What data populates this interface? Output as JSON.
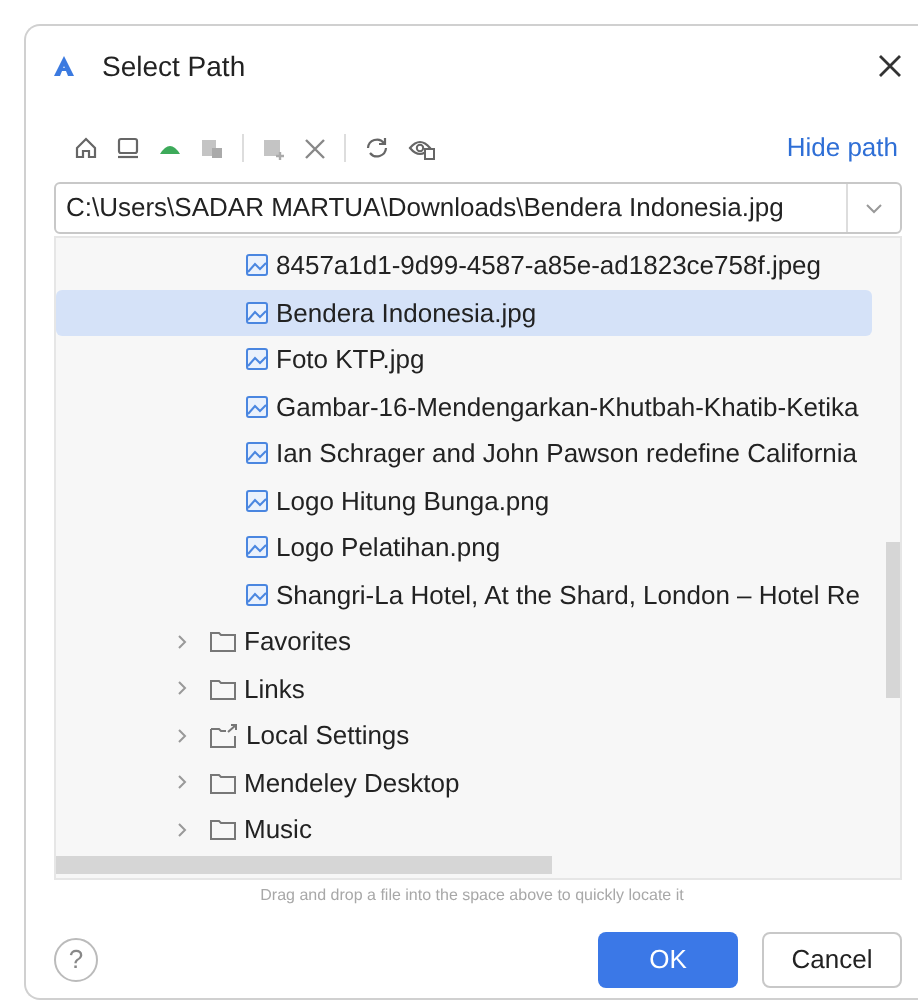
{
  "window": {
    "title": "Select Path"
  },
  "toolbar": {
    "hide_path_link": "Hide path"
  },
  "path_field": {
    "value": "C:\\Users\\SADAR MARTUA\\Downloads\\Bendera Indonesia.jpg"
  },
  "tree": [
    {
      "kind": "file",
      "label": "8457a1d1-9d99-4587-a85e-ad1823ce758f.jpeg",
      "selected": false
    },
    {
      "kind": "file",
      "label": "Bendera Indonesia.jpg",
      "selected": true
    },
    {
      "kind": "file",
      "label": "Foto KTP.jpg",
      "selected": false
    },
    {
      "kind": "file",
      "label": "Gambar-16-Mendengarkan-Khutbah-Khatib-Ketika",
      "selected": false
    },
    {
      "kind": "file",
      "label": "Ian Schrager and John Pawson redefine California",
      "selected": false
    },
    {
      "kind": "file",
      "label": "Logo Hitung Bunga.png",
      "selected": false
    },
    {
      "kind": "file",
      "label": "Logo Pelatihan.png",
      "selected": false
    },
    {
      "kind": "file",
      "label": "Shangri-La Hotel, At the Shard, London – Hotel Re",
      "selected": false
    },
    {
      "kind": "folder",
      "label": "Favorites",
      "selected": false,
      "expanded": false
    },
    {
      "kind": "folder",
      "label": "Links",
      "selected": false,
      "expanded": false
    },
    {
      "kind": "link_folder",
      "label": "Local Settings",
      "selected": false,
      "expanded": false
    },
    {
      "kind": "folder",
      "label": "Mendeley Desktop",
      "selected": false,
      "expanded": false
    },
    {
      "kind": "folder",
      "label": "Music",
      "selected": false,
      "expanded": false
    }
  ],
  "hint": "Drag and drop a file into the space above to quickly locate it",
  "help": {
    "label": "?"
  },
  "buttons": [
    {
      "kind": "primary",
      "label": "OK"
    },
    {
      "kind": "secondary",
      "label": "Cancel"
    }
  ]
}
